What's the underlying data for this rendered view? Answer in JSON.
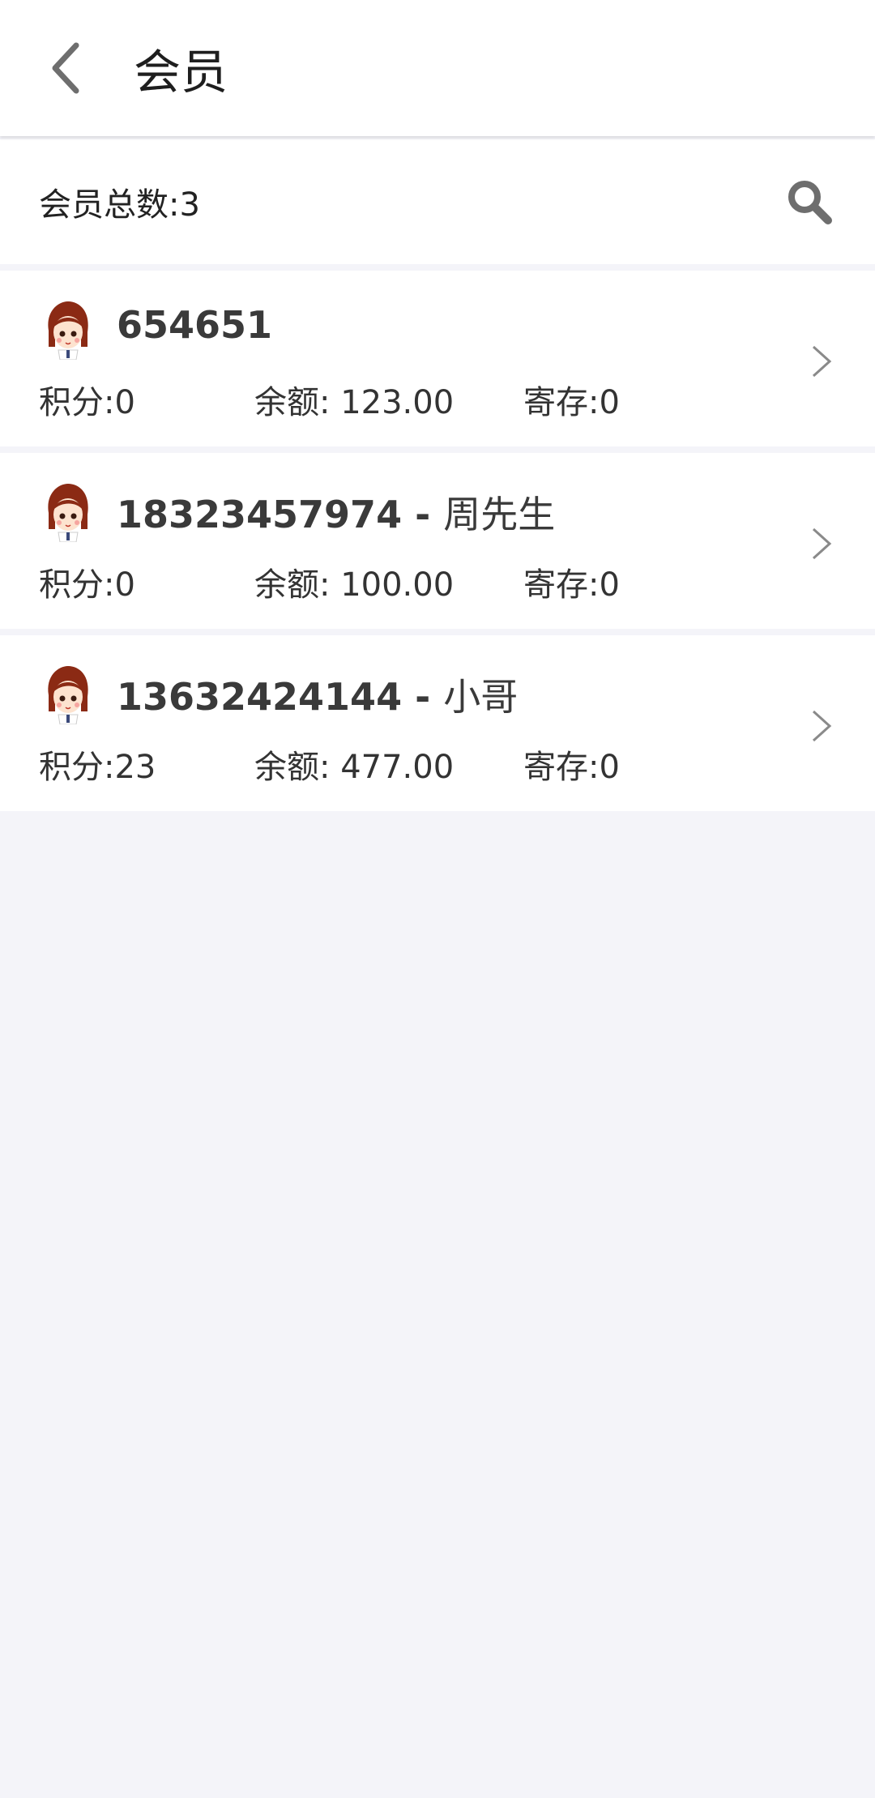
{
  "header": {
    "title": "会员"
  },
  "summary": {
    "total_label": "会员总数:3"
  },
  "members": [
    {
      "id": "654651",
      "separator": "",
      "nickname": "",
      "points": "积分:0",
      "balance": "余额: 123.00",
      "deposit": "寄存:0"
    },
    {
      "id": "18323457974",
      "separator": " - ",
      "nickname": "周先生",
      "points": "积分:0",
      "balance": "余额: 100.00",
      "deposit": "寄存:0"
    },
    {
      "id": "13632424144",
      "separator": " - ",
      "nickname": "小哥",
      "points": "积分:23",
      "balance": "余额: 477.00",
      "deposit": "寄存:0"
    }
  ],
  "icons": {
    "back": "chevron-left-icon",
    "search": "search-icon",
    "row_arrow": "chevron-right-icon",
    "avatar": "girl-avatar-icon"
  },
  "colors": {
    "background": "#f4f4f9",
    "surface": "#ffffff",
    "text_primary": "#1e1e1e",
    "text_name": "#3a3a3a",
    "icon_gray": "#6e6e6e"
  }
}
